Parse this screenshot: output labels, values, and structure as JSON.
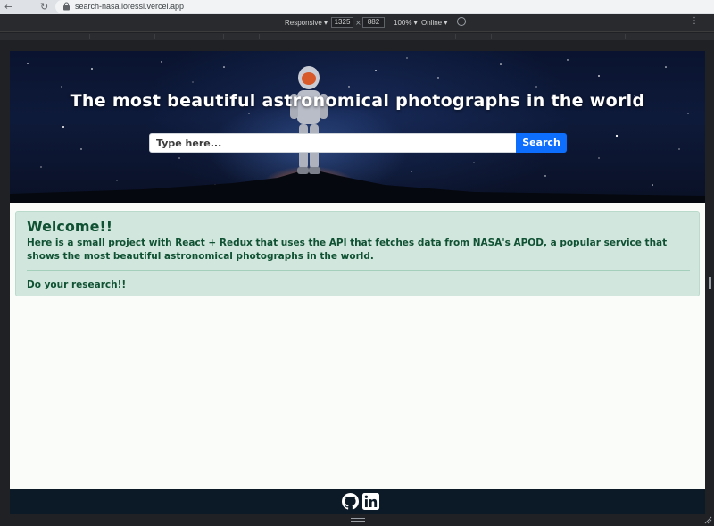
{
  "browser": {
    "url": "search-nasa.loressl.vercel.app",
    "back_icon": "arrow-left-icon",
    "reload_icon": "reload-icon"
  },
  "devtools": {
    "device": "Responsive ▾",
    "width": "1325",
    "times": "×",
    "height": "882",
    "zoom": "100% ▾",
    "network": "Online ▾",
    "more_icon": "kebab-menu-icon"
  },
  "hero": {
    "title": "The most beautiful astronomical photographs in the world",
    "search_placeholder": "Type here...",
    "search_button": "Search"
  },
  "alert": {
    "heading": "Welcome!!",
    "text": "Here is a small project with React + Redux that uses the API that fetches data from NASA's APOD, a popular service that shows the most beautiful astronomical photographs in the world.",
    "footer": "Do your research!!"
  },
  "footer": {
    "icons": [
      "github-icon",
      "linkedin-icon"
    ]
  },
  "colors": {
    "accent": "#0d6efd",
    "alert_bg": "#d1e7dd",
    "alert_text": "#0f5132",
    "footer_bg": "#0b1a26"
  }
}
